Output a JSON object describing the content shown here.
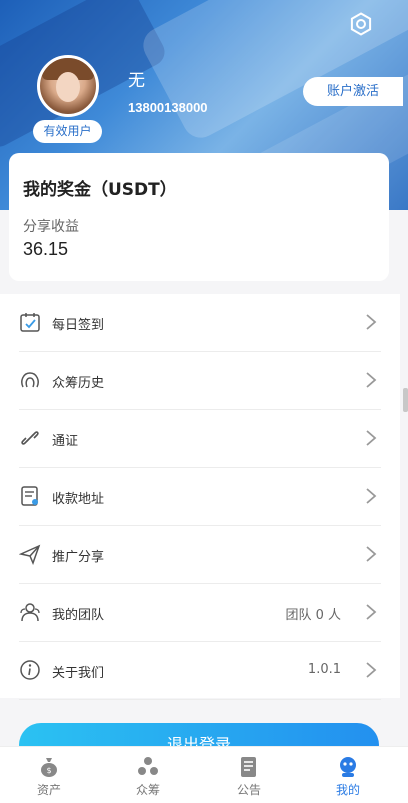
{
  "profile": {
    "username": "无",
    "phone": "13800138000",
    "status_badge": "有效用户",
    "activate_label": "账户激活"
  },
  "bonus": {
    "title": "我的奖金（USDT）",
    "share_label": "分享收益",
    "share_value": "36.15"
  },
  "menu": {
    "items": [
      {
        "label": "每日签到",
        "icon": "calendar-check-icon",
        "value": ""
      },
      {
        "label": "众筹历史",
        "icon": "crowdfund-history-icon",
        "value": ""
      },
      {
        "label": "通证",
        "icon": "link-icon",
        "value": ""
      },
      {
        "label": "收款地址",
        "icon": "document-icon",
        "value": ""
      },
      {
        "label": "推广分享",
        "icon": "paper-plane-icon",
        "value": ""
      },
      {
        "label": "我的团队",
        "icon": "team-icon",
        "value": "团队 0 人"
      },
      {
        "label": "关于我们",
        "icon": "info-icon",
        "value": "1.0.1"
      }
    ]
  },
  "logout_label": "退出登录",
  "tabbar": {
    "tabs": [
      {
        "label": "资产",
        "icon": "money-bag-icon",
        "active": false
      },
      {
        "label": "众筹",
        "icon": "crowdfund-icon",
        "active": false
      },
      {
        "label": "公告",
        "icon": "notice-icon",
        "active": false
      },
      {
        "label": "我的",
        "icon": "profile-icon",
        "active": true
      }
    ]
  },
  "colors": {
    "accent": "#2a7be4",
    "logout_gradient_start": "#2bc2f2",
    "logout_gradient_end": "#2390ef"
  }
}
